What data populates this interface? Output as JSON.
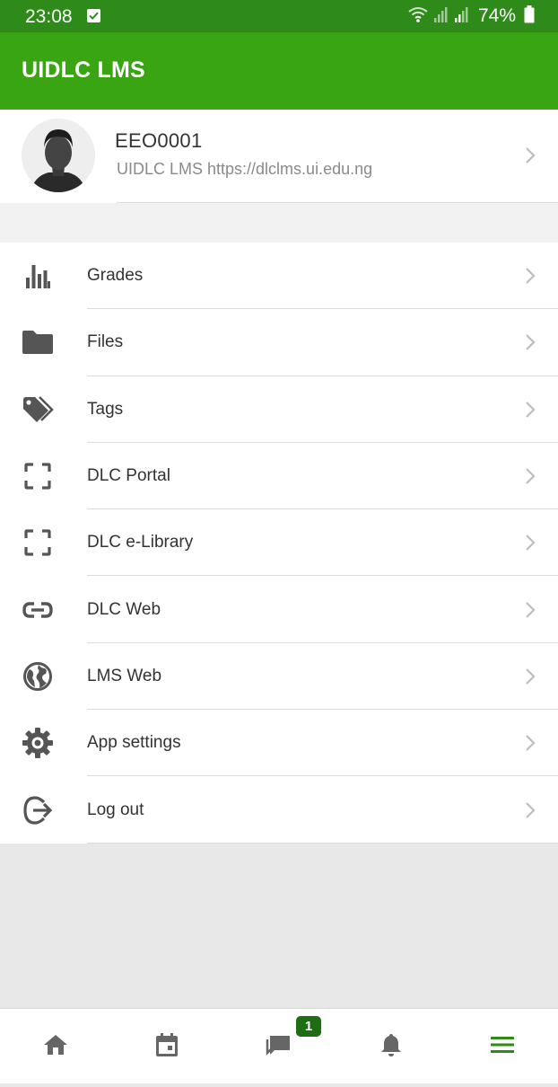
{
  "status_bar": {
    "time": "23:08",
    "battery": "74%"
  },
  "app_bar": {
    "title": "UIDLC LMS"
  },
  "profile": {
    "name": "EEO0001",
    "site": "UIDLC LMS https://dlclms.ui.edu.ng"
  },
  "menu": {
    "items": [
      {
        "label": "Grades",
        "icon": "bar-chart-icon"
      },
      {
        "label": "Files",
        "icon": "folder-icon"
      },
      {
        "label": "Tags",
        "icon": "tags-icon"
      },
      {
        "label": "DLC Portal",
        "icon": "fullscreen-icon"
      },
      {
        "label": "DLC e-Library",
        "icon": "fullscreen-icon"
      },
      {
        "label": "DLC Web",
        "icon": "link-icon"
      },
      {
        "label": "LMS Web",
        "icon": "globe-icon"
      },
      {
        "label": "App settings",
        "icon": "gear-icon"
      },
      {
        "label": "Log out",
        "icon": "logout-icon"
      }
    ]
  },
  "tab_bar": {
    "tabs": [
      {
        "name": "home",
        "icon": "home-icon"
      },
      {
        "name": "calendar",
        "icon": "calendar-icon"
      },
      {
        "name": "messages",
        "icon": "chat-icon"
      },
      {
        "name": "notifications",
        "icon": "bell-icon"
      },
      {
        "name": "more",
        "icon": "menu-icon"
      }
    ],
    "messages_badge": "1"
  },
  "colors": {
    "status_bar": "#2e8b1a",
    "app_bar": "#3aa512",
    "active_tab": "#2e8b1a",
    "icon_gray": "#555555"
  }
}
